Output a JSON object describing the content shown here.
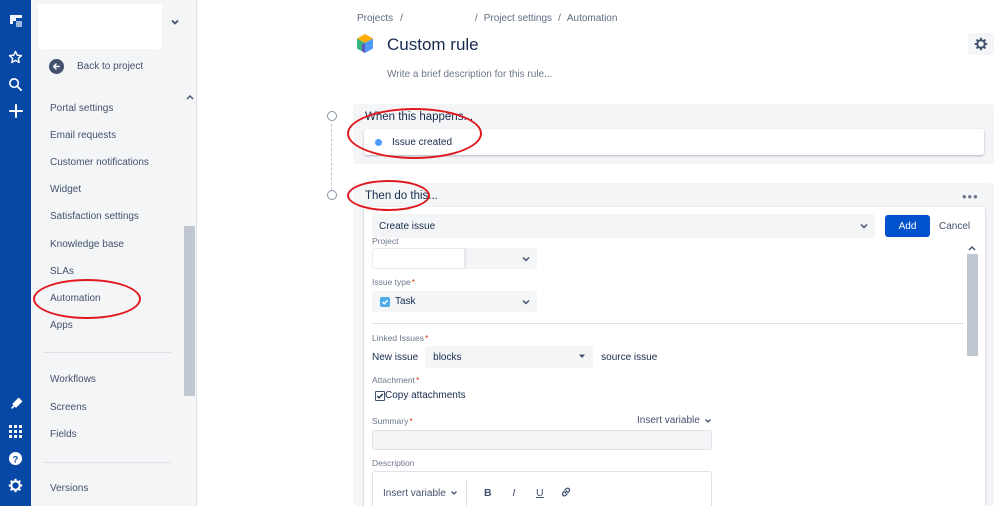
{
  "sidebar": {
    "back_label": "Back to project",
    "groups": [
      [
        "Portal settings",
        "Email requests",
        "Customer notifications",
        "Widget",
        "Satisfaction settings",
        "Knowledge base",
        "SLAs",
        "Automation",
        "Apps"
      ],
      [
        "Workflows",
        "Screens",
        "Fields"
      ],
      [
        "Versions"
      ]
    ]
  },
  "breadcrumb": {
    "projects": "Projects",
    "sep1": "/",
    "sep2": "/",
    "project_settings": "Project settings",
    "sep3": "/",
    "automation": "Automation"
  },
  "page": {
    "title": "Custom rule",
    "description_placeholder": "Write a brief description for this rule..."
  },
  "trigger": {
    "heading": "When this happens...",
    "item": "Issue created"
  },
  "action": {
    "heading": "Then do this...",
    "more": "•••",
    "selected": "Create issue",
    "add_label": "Add",
    "cancel_label": "Cancel",
    "form": {
      "project_label": "Project",
      "issue_type_label": "Issue type",
      "issue_type_value": "Task",
      "linked_issues_label": "Linked Issues",
      "linked_prefix": "New issue",
      "linked_value": "blocks",
      "linked_suffix": "source issue",
      "attachment_label": "Attachment",
      "copy_attachments": "Copy attachments",
      "summary_label": "Summary",
      "insert_variable": "Insert variable",
      "description_label": "Description",
      "toolbar_insert_variable": "Insert variable",
      "bold": "B",
      "italic": "I",
      "underline": "U",
      "required_mark": "*"
    }
  },
  "colors": {
    "global_nav": "#0747a6",
    "primary_button": "#0052cc",
    "annotation_red": "#e0191f",
    "trigger_dot": "#4c9aff",
    "task_icon": "#4bade8"
  }
}
